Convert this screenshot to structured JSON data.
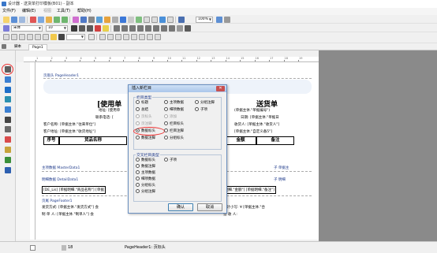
{
  "window": {
    "title": "设计器 - 送货单打印模板(B01) - 副本"
  },
  "menu": [
    {
      "label": "文件(F)",
      "enabled": true
    },
    {
      "label": "编辑(E)",
      "enabled": true
    },
    {
      "label": "视图",
      "enabled": false
    },
    {
      "label": "工具(T)",
      "enabled": true
    },
    {
      "label": "帮助(H)",
      "enabled": true
    }
  ],
  "toolbar": {
    "font_name": "宋体",
    "font_size": "10",
    "zoom": "100%"
  },
  "tabs": [
    {
      "label": "脚本",
      "active": false
    },
    {
      "label": "Page1",
      "active": true
    }
  ],
  "ruler": {
    "labels": [
      "1",
      "2",
      "3",
      "4",
      "5",
      "6",
      "7",
      "8",
      "9",
      "10",
      "11",
      "12",
      "13",
      "14",
      "15",
      "16",
      "17",
      "18",
      "19"
    ]
  },
  "report": {
    "page_header_band": "页眉头 PageHeader1",
    "title_left": "[使用单",
    "title_right": "送货单",
    "address_left": "地址: [使用单",
    "contact_left": "联系电话: [",
    "customer_name": "客户名称: [单据主体.\"往来单位\"]",
    "customer_address": "客户地址: [单据主体.\"收货地址\"]",
    "order_no": "(单据主体.\"单据编号\")",
    "date": "日期: [单据主体.\"单据日",
    "receiver": "收货人: [单据主体.\"收货人\"]",
    "remark": "[单据主体.\"自定义备5\"]",
    "table_headers": [
      "序号",
      "货品名称",
      "金额",
      "备注"
    ],
    "master_band": "主项数据 MasterData1",
    "master_band_right": "子 单据主",
    "detail_band": "明细数据 DetailData1",
    "detail_band_right": "子 明细",
    "detail_row_left": "[DE_Lis]  [单据明细.\"商品名称\"]   [单据",
    "detail_row_right": "明细.\"金额\"]  [单据明细.\"备注\"]",
    "footer_band": "页尾 PageFooter1",
    "footer_row1_left": "发货方式: [单据主体.\"发货方式\"]  会",
    "footer_row1_right": "会计小写: ¥ [单据主体.\"合",
    "footer_row2_left": "制  单  人: [单据主体.\"制单人\"]   会",
    "footer_row2_right": "签  收  人:"
  },
  "dialog": {
    "title": "插入新栏目",
    "group1_title": "栏目类型",
    "group1_items": [
      {
        "label": "标题",
        "enabled": true,
        "selected": false
      },
      {
        "label": "主项数据",
        "enabled": true,
        "selected": false
      },
      {
        "label": "分组注脚",
        "enabled": true,
        "selected": false
      },
      {
        "label": "总结",
        "enabled": true,
        "selected": false
      },
      {
        "label": "细项数据",
        "enabled": true,
        "selected": false
      },
      {
        "label": "子项",
        "enabled": true,
        "selected": false
      },
      {
        "label": "页标头",
        "enabled": false,
        "selected": false
      },
      {
        "label": "添加",
        "enabled": false,
        "selected": false
      },
      {
        "label": "页注脚",
        "enabled": false,
        "selected": false
      },
      {
        "label": "栏目标头",
        "enabled": true,
        "selected": false
      },
      {
        "label": "数据标头",
        "enabled": true,
        "selected": true
      },
      {
        "label": "栏目注脚",
        "enabled": true,
        "selected": false
      },
      {
        "label": "数据注脚",
        "enabled": true,
        "selected": false
      },
      {
        "label": "分组标头",
        "enabled": true,
        "selected": false
      }
    ],
    "group2_title": "交叉栏目类型",
    "group2_items": [
      {
        "label": "数据标头",
        "enabled": true
      },
      {
        "label": "子项",
        "enabled": true
      },
      {
        "label": "数据注脚",
        "enabled": true
      },
      {
        "label": "主项数据",
        "enabled": true
      },
      {
        "label": "细项数据",
        "enabled": true
      },
      {
        "label": "分组标头",
        "enabled": true
      },
      {
        "label": "分组注脚",
        "enabled": true
      }
    ],
    "ok_label": "确认",
    "cancel_label": "取消"
  },
  "statusbar": {
    "pos": "18",
    "band": "PageHeader1: 页标头"
  }
}
